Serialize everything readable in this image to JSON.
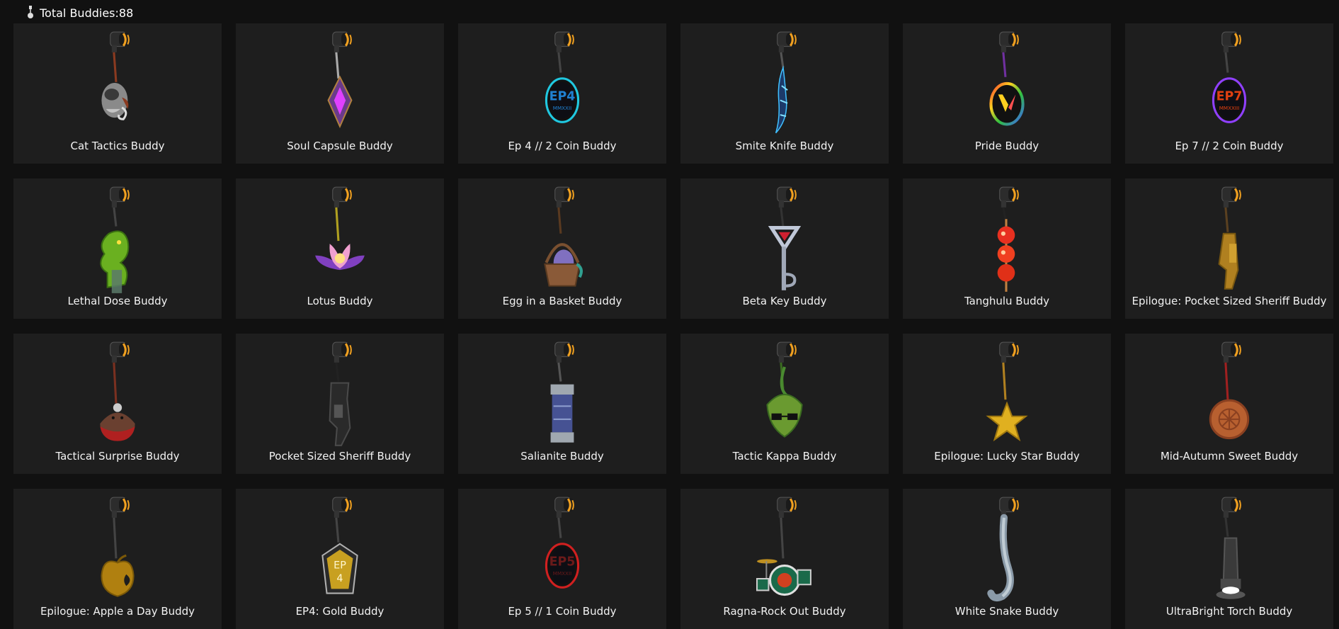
{
  "header": {
    "total_label": "Total Buddies:88",
    "icon": "buddy-charm-icon"
  },
  "colors": {
    "background": "#111111",
    "card": "#1e1e1e",
    "clip_band": "#f0a020",
    "clip_body": "#2a2a2a"
  },
  "buddies": [
    {
      "name": "Cat Tactics Buddy",
      "icon": "cat-tactics-buddy-icon"
    },
    {
      "name": "Soul Capsule Buddy",
      "icon": "soul-capsule-buddy-icon"
    },
    {
      "name": "Ep 4 // 2 Coin Buddy",
      "icon": "ep4-coin-buddy-icon"
    },
    {
      "name": "Smite Knife Buddy",
      "icon": "smite-knife-buddy-icon"
    },
    {
      "name": "Pride Buddy",
      "icon": "pride-buddy-icon"
    },
    {
      "name": "Ep 7 // 2 Coin Buddy",
      "icon": "ep7-coin-buddy-icon"
    },
    {
      "name": "Lethal Dose Buddy",
      "icon": "lethal-dose-buddy-icon"
    },
    {
      "name": "Lotus Buddy",
      "icon": "lotus-buddy-icon"
    },
    {
      "name": "Egg in a Basket Buddy",
      "icon": "egg-basket-buddy-icon"
    },
    {
      "name": "Beta Key Buddy",
      "icon": "beta-key-buddy-icon"
    },
    {
      "name": "Tanghulu Buddy",
      "icon": "tanghulu-buddy-icon"
    },
    {
      "name": "Epilogue: Pocket Sized Sheriff Buddy",
      "icon": "gold-sheriff-buddy-icon"
    },
    {
      "name": "Tactical Surprise Buddy",
      "icon": "tactical-surprise-buddy-icon"
    },
    {
      "name": "Pocket Sized Sheriff Buddy",
      "icon": "sheriff-buddy-icon"
    },
    {
      "name": "Salianite Buddy",
      "icon": "salianite-buddy-icon"
    },
    {
      "name": "Tactic Kappa Buddy",
      "icon": "kappa-buddy-icon"
    },
    {
      "name": "Epilogue: Lucky Star Buddy",
      "icon": "lucky-star-buddy-icon"
    },
    {
      "name": "Mid-Autumn Sweet Buddy",
      "icon": "mooncake-buddy-icon"
    },
    {
      "name": "Epilogue: Apple a Day Buddy",
      "icon": "golden-apple-buddy-icon"
    },
    {
      "name": "EP4: Gold Buddy",
      "icon": "ep4-gold-buddy-icon",
      "badge_text": "EP\n4"
    },
    {
      "name": "Ep 5 // 1 Coin Buddy",
      "icon": "ep5-coin-buddy-icon"
    },
    {
      "name": "Ragna-Rock Out Buddy",
      "icon": "drum-kit-buddy-icon"
    },
    {
      "name": "White Snake Buddy",
      "icon": "white-snake-buddy-icon"
    },
    {
      "name": "UltraBright Torch Buddy",
      "icon": "torch-buddy-icon"
    }
  ]
}
